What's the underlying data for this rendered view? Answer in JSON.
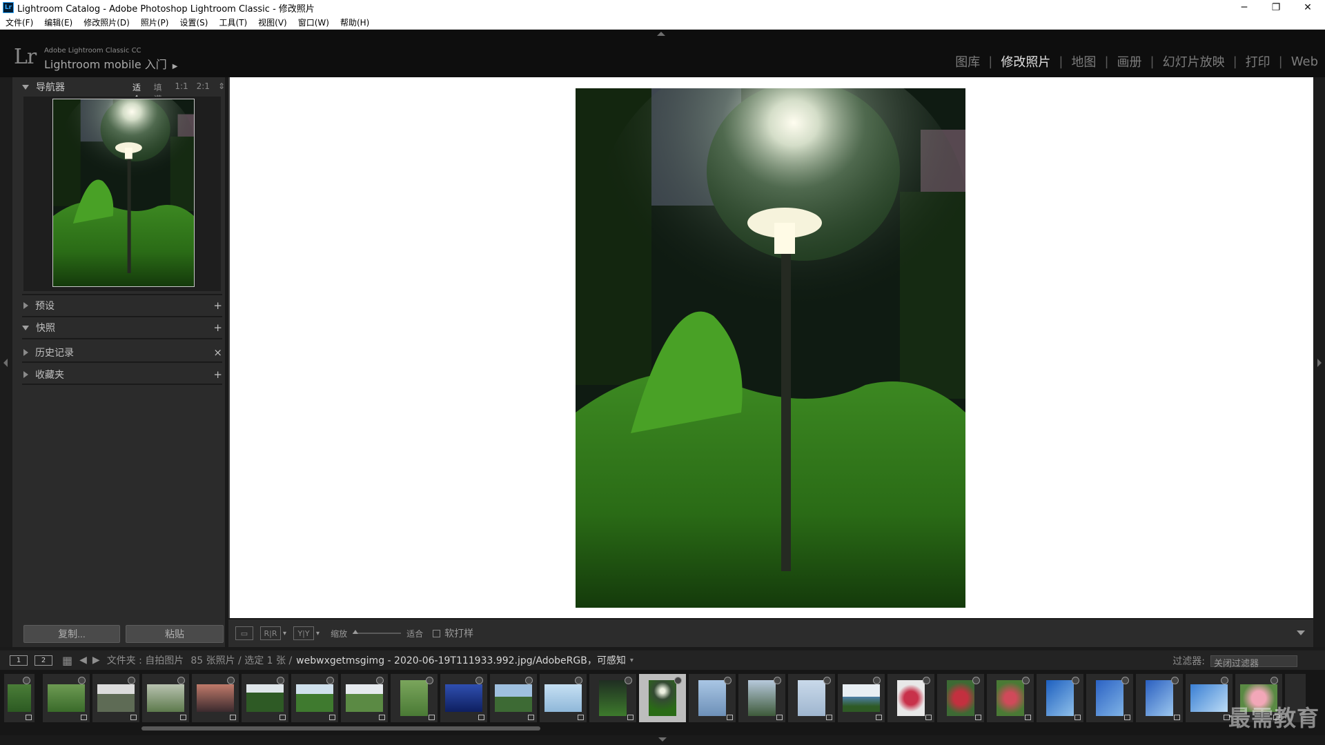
{
  "window": {
    "title": "Lightroom Catalog - Adobe Photoshop Lightroom Classic - 修改照片",
    "app_badge": "Lr"
  },
  "menu": [
    "文件(F)",
    "编辑(E)",
    "修改照片(D)",
    "照片(P)",
    "设置(S)",
    "工具(T)",
    "视图(V)",
    "窗口(W)",
    "帮助(H)"
  ],
  "identity": {
    "logo": "Lr",
    "small": "Adobe Lightroom Classic CC",
    "big": "Lightroom mobile 入门",
    "arrow": "▶"
  },
  "modules": [
    "图库",
    "修改照片",
    "地图",
    "画册",
    "幻灯片放映",
    "打印",
    "Web"
  ],
  "active_module": "修改照片",
  "navigator": {
    "title": "导航器",
    "zoom": [
      "适合",
      "填满",
      "1:1",
      "2:1"
    ]
  },
  "panels": [
    {
      "label": "预设",
      "action": "+"
    },
    {
      "label": "快照",
      "action": "+"
    },
    {
      "label": "历史记录",
      "action": "×"
    },
    {
      "label": "收藏夹",
      "action": "+"
    }
  ],
  "buttons": {
    "copy": "复制...",
    "paste": "粘贴"
  },
  "toolbar": {
    "zoom_label": "缩放",
    "zoom_value": "适合",
    "soft_proof": "软打样"
  },
  "filmstrip_bar": {
    "monitors": [
      "1",
      "2"
    ],
    "path": "文件夹 : 自拍图片",
    "count": "85 张照片 / 选定 1 张 /",
    "file": "webwxgetmsgimg - 2020-06-19T111933.992.jpg/AdobeRGB，可感知",
    "filter_label": "过滤器:",
    "filter_value": "关闭过滤器"
  },
  "watermark": "最需教育",
  "colors": {
    "app_bg": "#1a1a1a",
    "panel": "#2b2b2b",
    "canvas": "#ffffff",
    "active_module": "#e2e2e2"
  }
}
